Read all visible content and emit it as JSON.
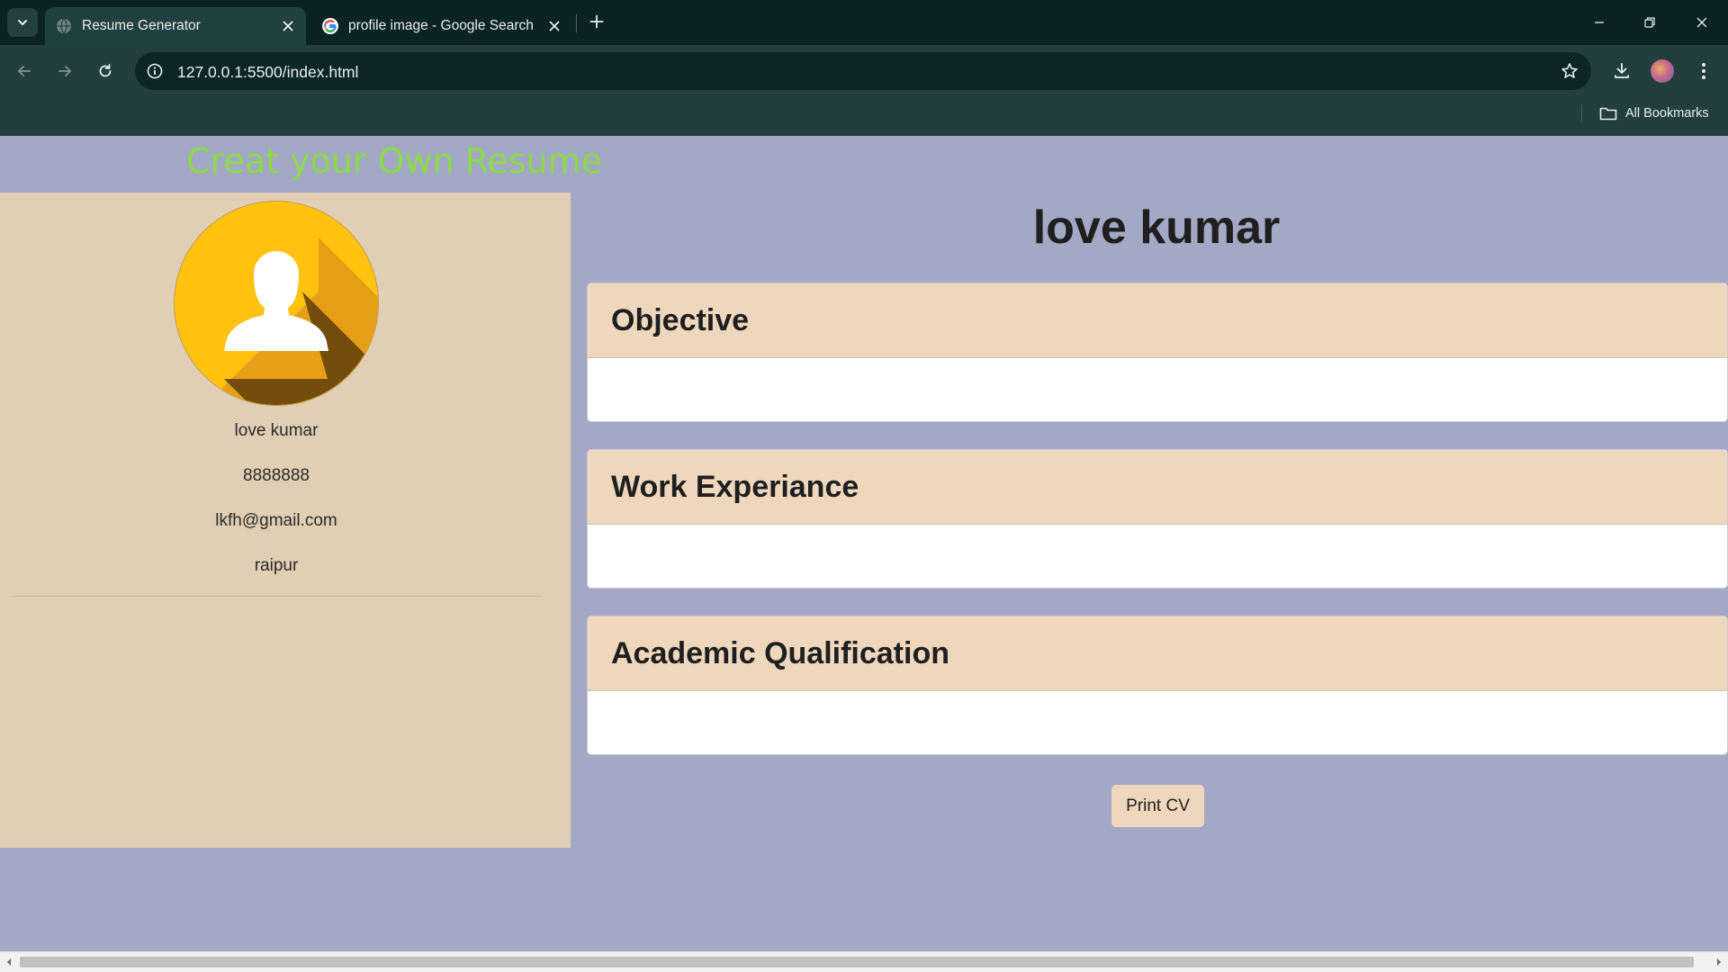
{
  "browser": {
    "tabs": [
      {
        "title": "Resume Generator",
        "active": true,
        "favicon": "globe-icon"
      },
      {
        "title": "profile image - Google Search",
        "active": false,
        "favicon": "google-g-icon"
      }
    ],
    "url": "127.0.0.1:5500/index.html",
    "bookmarks_label": "All Bookmarks",
    "colors": {
      "chrome_dark": "#0b2323",
      "toolbar": "#223e3d"
    }
  },
  "page": {
    "heading": "Creat your Own Resume",
    "sidebar": {
      "image_icon": "user-silhouette-icon",
      "name": "love kumar",
      "phone": "8888888",
      "email": "lkfh@gmail.com",
      "address": "raipur"
    },
    "main": {
      "name": "love kumar",
      "sections": [
        {
          "title": "Objective",
          "content": ""
        },
        {
          "title": "Work Experiance",
          "content": ""
        },
        {
          "title": "Academic Qualification",
          "content": ""
        }
      ],
      "print_label": "Print CV"
    },
    "colors": {
      "background": "#a3a8c4",
      "sidebar": "#e0cfb4",
      "card_header": "#eed7bd",
      "heading": "#8cd94a",
      "avatar_yellow": "#ffc20e"
    }
  }
}
